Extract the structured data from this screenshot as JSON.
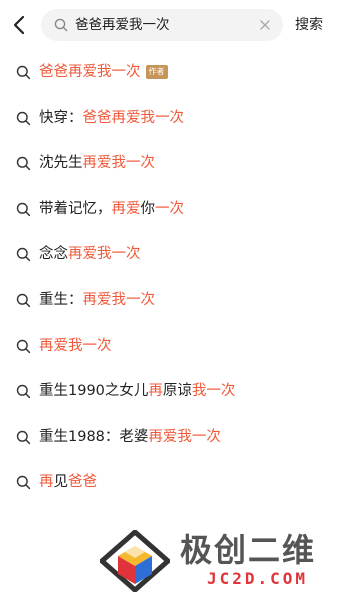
{
  "header": {
    "back_icon": "chevron-left-icon",
    "search": {
      "query": "爸爸再爱我一次",
      "search_icon": "search-icon",
      "clear_icon": "clear-icon"
    },
    "search_button": "搜索"
  },
  "suggestions": [
    {
      "parts": [
        {
          "t": "爸爸再爱我一次",
          "hl": true
        }
      ],
      "tag": "作者"
    },
    {
      "parts": [
        {
          "t": "快穿：",
          "hl": false
        },
        {
          "t": "爸爸再爱我一次",
          "hl": true
        }
      ]
    },
    {
      "parts": [
        {
          "t": "沈先生",
          "hl": false
        },
        {
          "t": "再爱我一次",
          "hl": true
        }
      ]
    },
    {
      "parts": [
        {
          "t": "带着记忆，",
          "hl": false
        },
        {
          "t": "再爱",
          "hl": true
        },
        {
          "t": "你",
          "hl": false
        },
        {
          "t": "一次",
          "hl": true
        }
      ]
    },
    {
      "parts": [
        {
          "t": "念念",
          "hl": false
        },
        {
          "t": "再爱我一次",
          "hl": true
        }
      ]
    },
    {
      "parts": [
        {
          "t": "重生：",
          "hl": false
        },
        {
          "t": "再爱我一次",
          "hl": true
        }
      ]
    },
    {
      "parts": [
        {
          "t": "再爱我一次",
          "hl": true
        }
      ]
    },
    {
      "parts": [
        {
          "t": "重生1990之女儿",
          "hl": false
        },
        {
          "t": "再",
          "hl": true
        },
        {
          "t": "原谅",
          "hl": false
        },
        {
          "t": "我一次",
          "hl": true
        }
      ]
    },
    {
      "parts": [
        {
          "t": "重生1988：老婆",
          "hl": false
        },
        {
          "t": "再爱我一次",
          "hl": true
        }
      ]
    },
    {
      "parts": [
        {
          "t": "再",
          "hl": true
        },
        {
          "t": "见",
          "hl": false
        },
        {
          "t": "爸爸",
          "hl": true
        }
      ]
    }
  ],
  "watermark": {
    "title": "极创二维",
    "subtitle": "JC2D.COM"
  },
  "colors": {
    "highlight": "#f05a3b",
    "tag_bg": "#c79559",
    "search_bg": "#f3f3f3"
  }
}
